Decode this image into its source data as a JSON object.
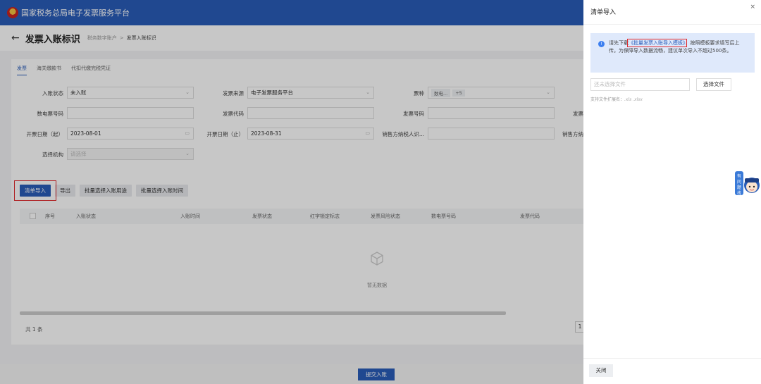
{
  "header": {
    "title": "国家税务总局电子发票服务平台"
  },
  "page": {
    "title": "发票入账标识",
    "breadcrumb": [
      "税务数字账户",
      "发票入账标识"
    ],
    "breadcrumb_sep": ">"
  },
  "tabs": [
    "发票",
    "海关缴款书",
    "代扣代缴完税凭证"
  ],
  "form": {
    "rows": [
      [
        {
          "label": "入账状态",
          "value": "未入账",
          "type": "select"
        },
        {
          "label": "发票来源",
          "value": "电子发票服务平台",
          "type": "select"
        },
        {
          "label": "票种",
          "type": "tags",
          "tags": [
            "数电...",
            "+5"
          ]
        }
      ],
      [
        {
          "label": "数电票号码",
          "value": "",
          "type": "text"
        },
        {
          "label": "发票代码",
          "value": "",
          "type": "text"
        },
        {
          "label": "发票号码",
          "value": "",
          "type": "text"
        },
        {
          "label": "发票",
          "value": "",
          "type": "clipped"
        }
      ],
      [
        {
          "label": "开票日期（起）",
          "value": "2023-08-01",
          "type": "date"
        },
        {
          "label": "开票日期（止）",
          "value": "2023-08-31",
          "type": "date"
        },
        {
          "label": "销售方纳税人识...",
          "value": "",
          "type": "text"
        },
        {
          "label": "销售方纳",
          "value": "",
          "type": "clipped"
        }
      ],
      [
        {
          "label": "选择机构",
          "placeholder": "请选择",
          "type": "select-disabled"
        }
      ]
    ]
  },
  "actions": [
    "清单导入",
    "导出",
    "批量选择入账用途",
    "批量选择入账时间"
  ],
  "table": {
    "columns": [
      "序号",
      "入账状态",
      "入账时间",
      "发票状态",
      "红字锁定标志",
      "发票风险状态",
      "数电票号码",
      "发票代码"
    ],
    "empty_text": "暂无数据"
  },
  "pagination": {
    "total": "共 1 条",
    "page": "1"
  },
  "footer": {
    "submit_label": "提交入账"
  },
  "drawer": {
    "title": "清单导入",
    "close_glyph": "×",
    "info": {
      "prefix": "请先下载",
      "link": "《批量发票入账导入模板》",
      "suffix": "，按照模板要求填写后上传。为保障导入数据流畅，建议单次导入不超过500条。"
    },
    "file_placeholder": "还未选择文件",
    "choose_file_label": "选择文件",
    "hint_label": "支持文件扩展名：",
    "hint_ext": ".xls .xlsx",
    "mascot_text": "有问题找我",
    "close_label": "关闭"
  },
  "colors": {
    "brand": "#2a5db9",
    "highlight": "#e0292d",
    "info_bg": "#dfe9fb"
  }
}
